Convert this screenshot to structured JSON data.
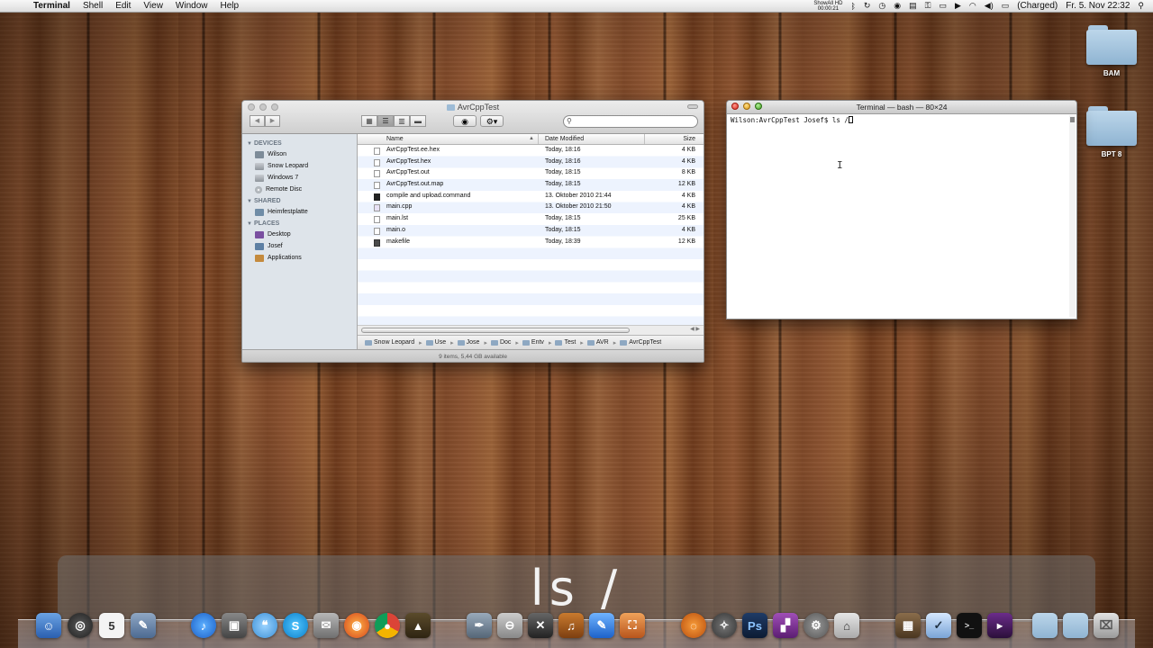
{
  "menubar": {
    "app": "Terminal",
    "items": [
      "Shell",
      "Edit",
      "View",
      "Window",
      "Help"
    ],
    "recording": "ShowAll HD",
    "recording_time": "00:00:21",
    "battery": "(Charged)",
    "clock": "Fr. 5. Nov  22:32"
  },
  "desktop": {
    "items": [
      {
        "label": "BAM"
      },
      {
        "label": "BPT 8"
      }
    ]
  },
  "finder": {
    "title": "AvrCppTest",
    "search_placeholder": "",
    "sidebar": {
      "devices_header": "DEVICES",
      "devices": [
        "Wilson",
        "Snow Leopard",
        "Windows 7",
        "Remote Disc"
      ],
      "shared_header": "SHARED",
      "shared": [
        "Heimfestplatte"
      ],
      "places_header": "PLACES",
      "places": [
        "Desktop",
        "Josef",
        "Applications"
      ]
    },
    "columns": {
      "name": "Name",
      "date": "Date Modified",
      "size": "Size"
    },
    "files": [
      {
        "name": "AvrCppTest.ee.hex",
        "date": "Today, 18:16",
        "size": "4 KB"
      },
      {
        "name": "AvrCppTest.hex",
        "date": "Today, 18:16",
        "size": "4 KB"
      },
      {
        "name": "AvrCppTest.out",
        "date": "Today, 18:15",
        "size": "8 KB"
      },
      {
        "name": "AvrCppTest.out.map",
        "date": "Today, 18:15",
        "size": "12 KB"
      },
      {
        "name": "compile and upload.command",
        "date": "13. Oktober 2010 21:44",
        "size": "4 KB"
      },
      {
        "name": "main.cpp",
        "date": "13. Oktober 2010 21:50",
        "size": "4 KB"
      },
      {
        "name": "main.lst",
        "date": "Today, 18:15",
        "size": "25 KB"
      },
      {
        "name": "main.o",
        "date": "Today, 18:15",
        "size": "4 KB"
      },
      {
        "name": "makefile",
        "date": "Today, 18:39",
        "size": "12 KB"
      }
    ],
    "path": [
      "Snow Leopard",
      "Use",
      "Jose",
      "Doc",
      "Entv",
      "Test",
      "AVR",
      "AvrCppTest"
    ],
    "status": "9 items, 5,44 GB available"
  },
  "terminal": {
    "title": "Terminal — bash — 80×24",
    "prompt": "Wilson:AvrCppTest Josef$ ls /"
  },
  "keystroke_overlay": "ls /"
}
